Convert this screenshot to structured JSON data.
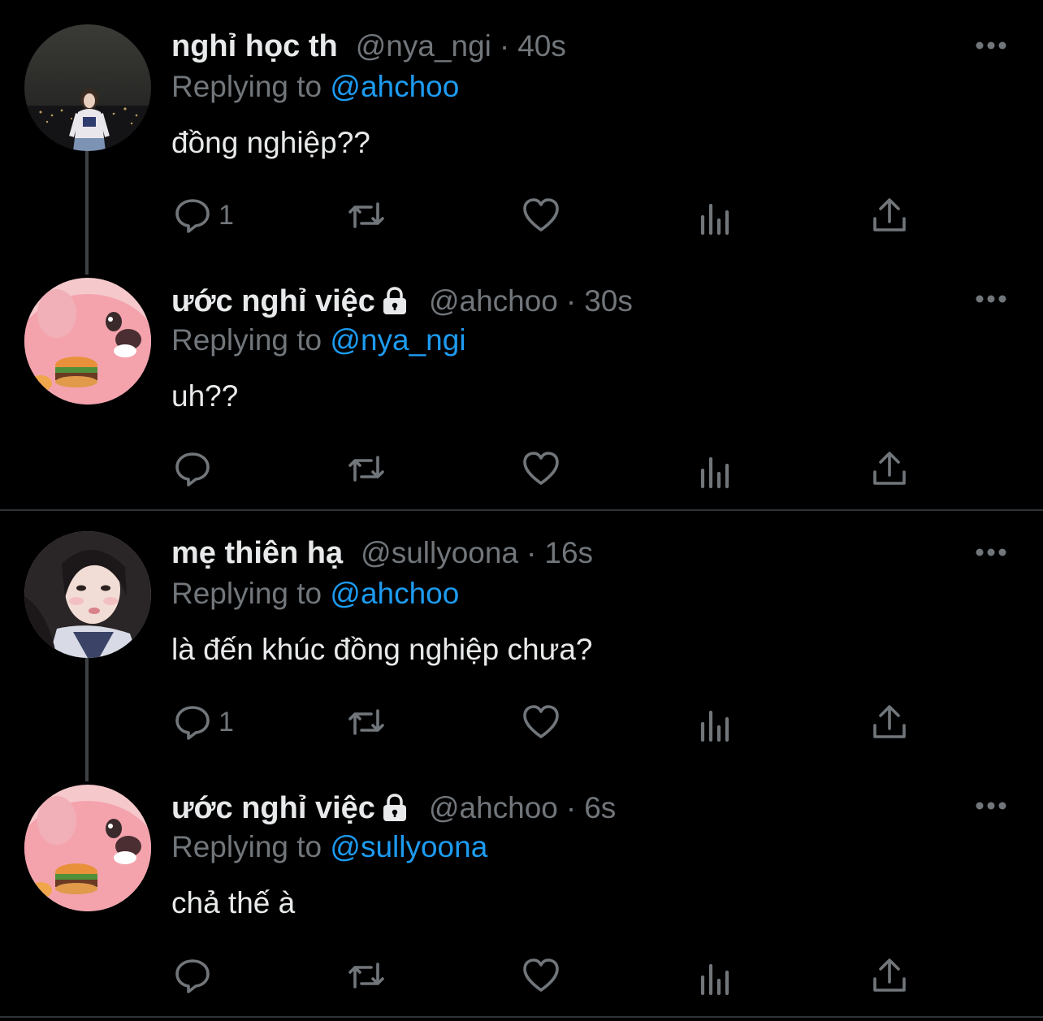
{
  "tweets": [
    {
      "name": "nghỉ học th",
      "locked": false,
      "handle": "@nya_ngi",
      "dot": "·",
      "time": "40s",
      "replying_prefix": "Replying to",
      "replying_to": "@ahchoo",
      "text": "đồng nghiệp??",
      "reply_count": "1",
      "avatar": "avatar-girl-night-city"
    },
    {
      "name": "ước nghỉ việc",
      "locked": true,
      "handle": "@ahchoo",
      "dot": "·",
      "time": "30s",
      "replying_prefix": "Replying to",
      "replying_to": "@nya_ngi",
      "text": "uh??",
      "reply_count": "",
      "avatar": "avatar-pink-beaver-burger"
    },
    {
      "name": "mẹ thiên hạ",
      "locked": false,
      "handle": "@sullyoona",
      "dot": "·",
      "time": "16s",
      "replying_prefix": "Replying to",
      "replying_to": "@ahchoo",
      "text": "là đến khúc đồng nghiệp chưa?",
      "reply_count": "1",
      "avatar": "avatar-girl-selfie"
    },
    {
      "name": "ước nghỉ việc",
      "locked": true,
      "handle": "@ahchoo",
      "dot": "·",
      "time": "6s",
      "replying_prefix": "Replying to",
      "replying_to": "@sullyoona",
      "text": "chả thế à",
      "reply_count": "",
      "avatar": "avatar-pink-beaver-burger"
    }
  ],
  "colors": {
    "background": "#000000",
    "text_primary": "#e7e9ea",
    "text_secondary": "#71767b",
    "accent": "#1d9bf0",
    "thread_line": "#3e4144",
    "divider": "#2f3336"
  },
  "icons": [
    "reply-icon",
    "retweet-icon",
    "like-icon",
    "views-icon",
    "share-icon",
    "more-icon",
    "lock-icon"
  ]
}
